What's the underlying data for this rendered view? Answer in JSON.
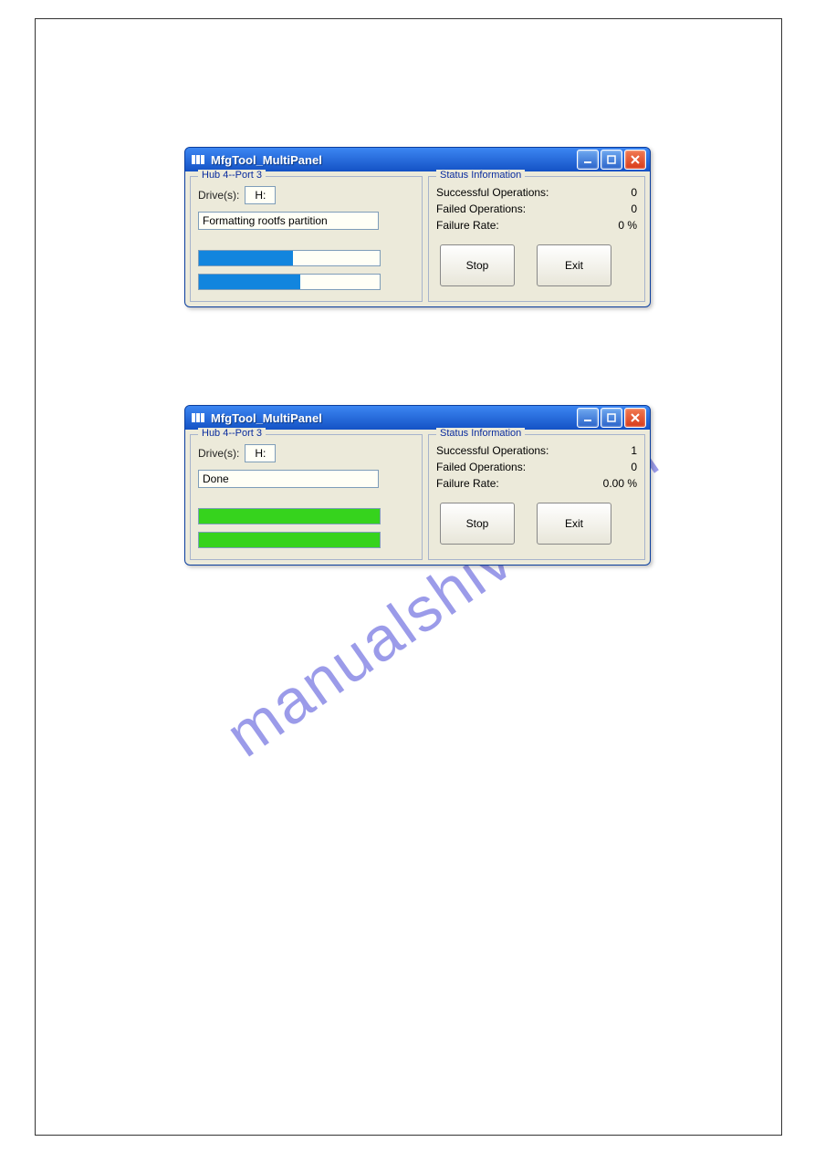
{
  "watermark_text": "manualshive.com",
  "windows": [
    {
      "title": "MfgTool_MultiPanel",
      "hub_label": "Hub 4--Port 3",
      "drives_label": "Drive(s):",
      "drive_value": "H:",
      "status_text": "Formatting rootfs partition",
      "progress1_width": "52%",
      "progress2_width": "56%",
      "progress_color": "blue",
      "status_legend": "Status Information",
      "rows": [
        {
          "k": "Successful Operations:",
          "v": "0"
        },
        {
          "k": "Failed Operations:",
          "v": "0"
        },
        {
          "k": "Failure Rate:",
          "v": "0 %"
        }
      ],
      "stop_label": "Stop",
      "exit_label": "Exit"
    },
    {
      "title": "MfgTool_MultiPanel",
      "hub_label": "Hub 4--Port 3",
      "drives_label": "Drive(s):",
      "drive_value": "H:",
      "status_text": "Done",
      "progress1_width": "100%",
      "progress2_width": "100%",
      "progress_color": "green",
      "status_legend": "Status Information",
      "rows": [
        {
          "k": "Successful Operations:",
          "v": "1"
        },
        {
          "k": "Failed Operations:",
          "v": "0"
        },
        {
          "k": "Failure Rate:",
          "v": "0.00 %"
        }
      ],
      "stop_label": "Stop",
      "exit_label": "Exit"
    }
  ]
}
